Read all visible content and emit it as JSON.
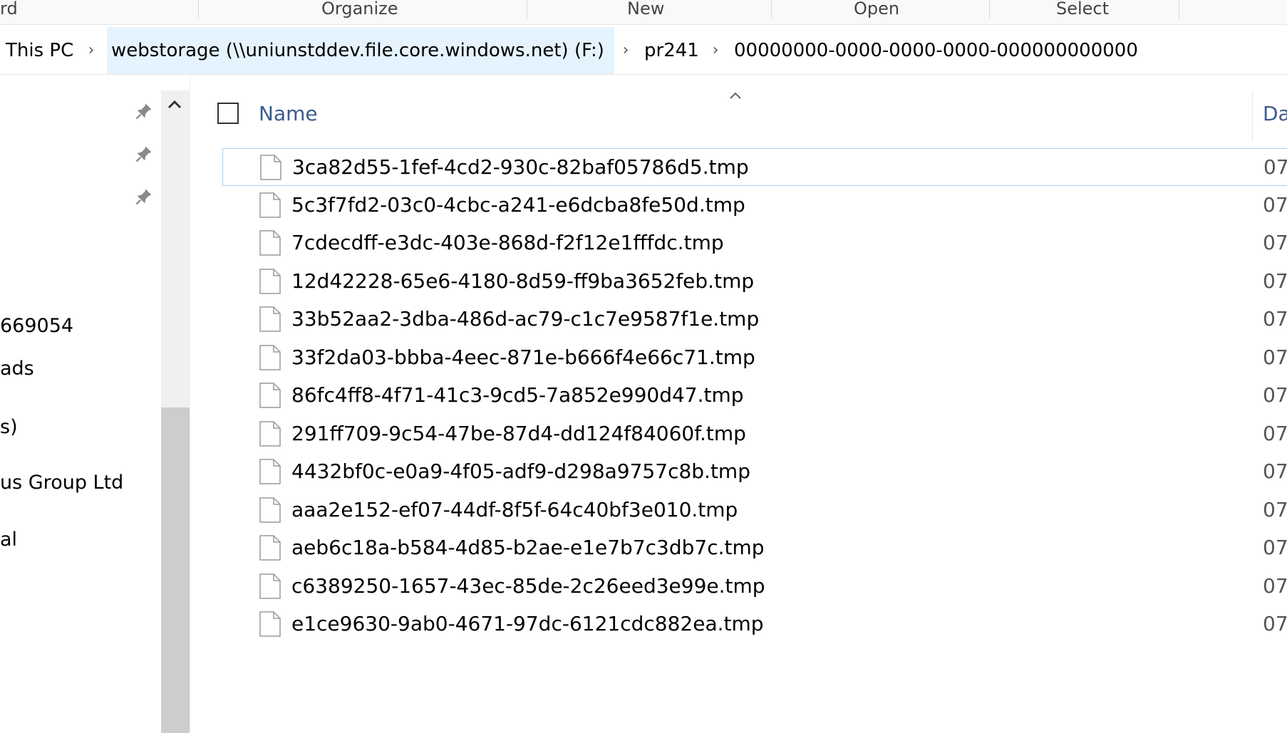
{
  "ribbon": {
    "groups": [
      "rd",
      "Organize",
      "New",
      "Open",
      "Select"
    ]
  },
  "address": {
    "crumbs": [
      "This PC",
      "webstorage (\\\\uniunstddev.file.core.windows.net) (F:)",
      "pr241",
      "00000000-0000-0000-0000-000000000000"
    ]
  },
  "nav": {
    "items": [
      "669054",
      "ads",
      "s)",
      "us Group Ltd",
      "al"
    ]
  },
  "columns": {
    "name": "Name",
    "date": "Da"
  },
  "files": [
    {
      "name": "3ca82d55-1fef-4cd2-930c-82baf05786d5.tmp",
      "date": "07/"
    },
    {
      "name": "5c3f7fd2-03c0-4cbc-a241-e6dcba8fe50d.tmp",
      "date": "07/"
    },
    {
      "name": "7cdecdff-e3dc-403e-868d-f2f12e1fffdc.tmp",
      "date": "07/"
    },
    {
      "name": "12d42228-65e6-4180-8d59-ff9ba3652feb.tmp",
      "date": "07/"
    },
    {
      "name": "33b52aa2-3dba-486d-ac79-c1c7e9587f1e.tmp",
      "date": "07/"
    },
    {
      "name": "33f2da03-bbba-4eec-871e-b666f4e66c71.tmp",
      "date": "07/"
    },
    {
      "name": "86fc4ff8-4f71-41c3-9cd5-7a852e990d47.tmp",
      "date": "07/"
    },
    {
      "name": "291ff709-9c54-47be-87d4-dd124f84060f.tmp",
      "date": "07/"
    },
    {
      "name": "4432bf0c-e0a9-4f05-adf9-d298a9757c8b.tmp",
      "date": "07/"
    },
    {
      "name": "aaa2e152-ef07-44df-8f5f-64c40bf3e010.tmp",
      "date": "07/"
    },
    {
      "name": "aeb6c18a-b584-4d85-b2ae-e1e7b7c3db7c.tmp",
      "date": "07/"
    },
    {
      "name": "c6389250-1657-43ec-85de-2c26eed3e99e.tmp",
      "date": "07/"
    },
    {
      "name": "e1ce9630-9ab0-4671-97dc-6121cdc882ea.tmp",
      "date": "07/"
    }
  ],
  "icons": {
    "pin": "pin-icon",
    "file": "file-icon",
    "chevron": "chevron-right-icon",
    "sort": "sort-ascending-icon",
    "scroll_up": "scroll-up-arrow-icon"
  },
  "colors": {
    "accent_selected": "#e5f3ff",
    "focus_border": "#99d1ff",
    "header_text": "#3a5a8c"
  }
}
